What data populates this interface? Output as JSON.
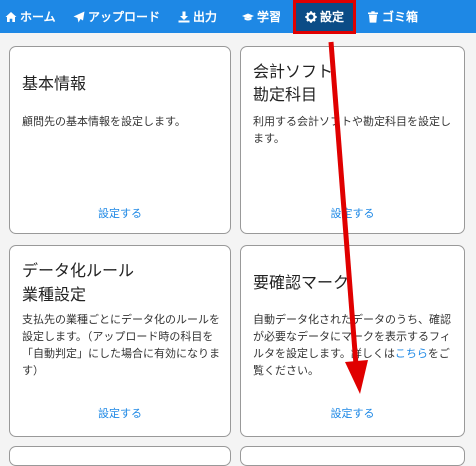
{
  "nav": {
    "items": [
      {
        "label": "ホーム",
        "icon": "home-icon"
      },
      {
        "label": "アップロード",
        "icon": "paper-plane-icon"
      },
      {
        "label": "出力",
        "icon": "download-icon"
      },
      {
        "label": "学習",
        "icon": "graduation-cap-icon"
      },
      {
        "label": "設定",
        "icon": "gear-icon"
      },
      {
        "label": "ゴミ箱",
        "icon": "trash-icon"
      }
    ],
    "active": "設定"
  },
  "cards": [
    {
      "title_line1": "基本情報",
      "title_line2": "",
      "desc": "顧問先の基本情報を設定します。",
      "link": "設定する"
    },
    {
      "title_line1": "会計ソフト",
      "title_line2": "勘定科目",
      "desc": "利用する会計ソフトや勘定科目を設定します。",
      "link": "設定する"
    },
    {
      "title_line1": "データ化ルール",
      "title_line2": "業種設定",
      "desc": "支払先の業種ごとにデータ化のルールを設定します。（アップロード時の科目を「自動判定」にした場合に有効になります）",
      "link": "設定する"
    },
    {
      "title_line1": "要確認マーク",
      "title_line2": "",
      "desc_before": "自動データ化されたデータのうち、確認が必要なデータにマークを表示するフィルタを設定します。詳しくは",
      "desc_link": "こちら",
      "desc_after": "をご覧ください。",
      "link": "設定する"
    }
  ],
  "colors": {
    "nav_bg": "#1e88e5",
    "nav_active": "#0b4c86",
    "annotation": "#e00000",
    "link": "#1e88e5"
  }
}
